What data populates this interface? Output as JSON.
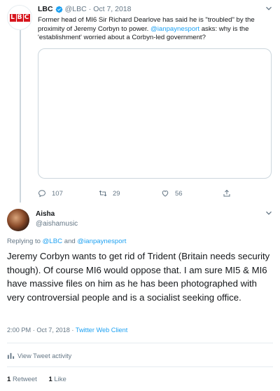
{
  "parent_tweet": {
    "display_name": "LBC",
    "handle": "@LBC",
    "separator": "·",
    "date": "Oct 7, 2018",
    "text_before": "Former head of MI6 Sir Richard Dearlove has said he is \"troubled\" by the proximity of Jeremy Corbyn to power. ",
    "mention": "@ianpaynesport",
    "text_after": " asks: why is the 'establishment' worried about a Corbyn-led government?",
    "logo_letters": [
      "L",
      "B",
      "C"
    ],
    "reply_count": "107",
    "retweet_count": "29",
    "like_count": "56"
  },
  "reply_tweet": {
    "display_name": "Aisha",
    "handle": "@aishamusic",
    "replying_prefix": "Replying to ",
    "replying_user1": "@LBC",
    "replying_and": " and ",
    "replying_user2": "@ianpaynesport",
    "text": "Jeremy Corbyn wants to get rid of Trident (Britain needs security though). Of course MI6 would oppose that. I am sure MI5 & MI6 have massive files on him as he has been photographed with very controversial people and is a socialist seeking office.",
    "timestamp": "2:00 PM · Oct 7, 2018 · ",
    "source": "Twitter Web Client",
    "activity_label": "View Tweet activity",
    "retweets_count": "1",
    "retweets_label": "Retweet",
    "likes_count": "1",
    "likes_label": "Like"
  },
  "colors": {
    "accent": "#1da1f2",
    "muted": "#657786",
    "border": "#e6ecf0",
    "lbc_red": "#d7161e"
  }
}
